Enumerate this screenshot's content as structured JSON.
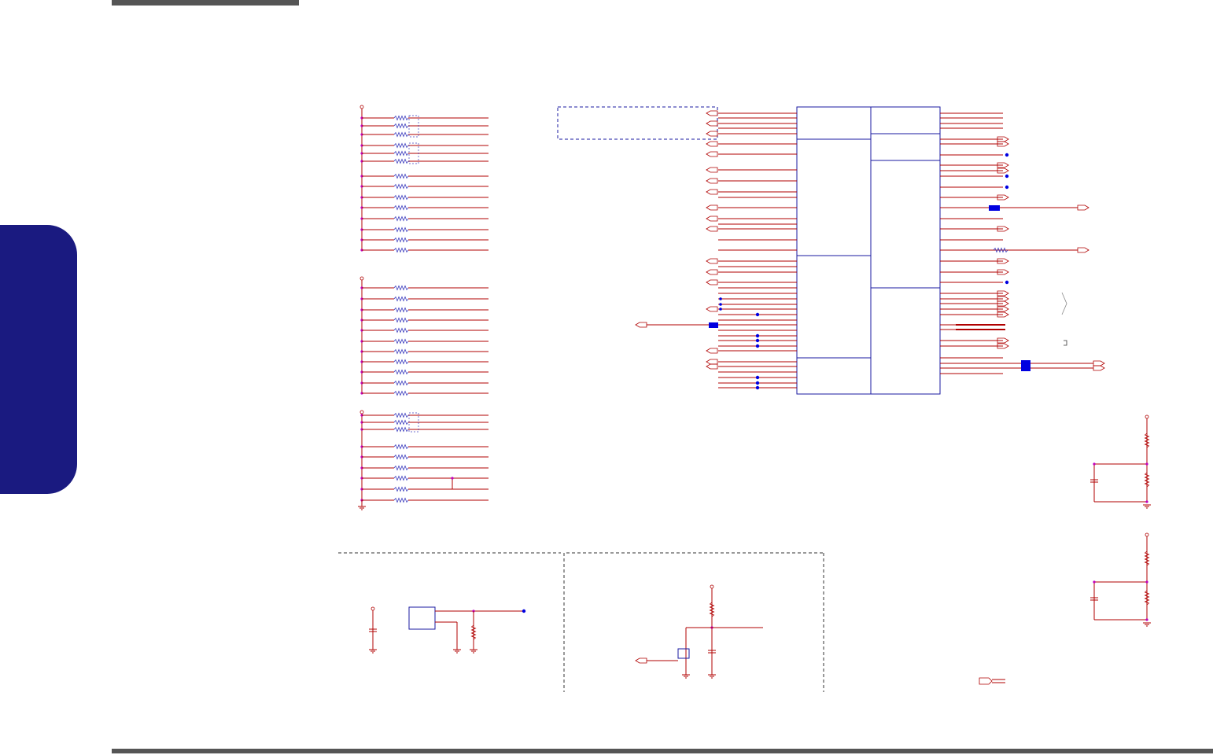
{
  "page": {
    "header_bar": "",
    "side_tab_label": "",
    "footer_bar": ""
  },
  "schematic": {
    "colors": {
      "wire": "#b00000",
      "bus_box": "#1a1aa0",
      "component": "#4040c0",
      "pin_marker": "#c000c0",
      "junction": "#0000e0",
      "ground": "#b00000"
    },
    "blocks": [
      "pull-up-resistor-bank-1",
      "pull-up-resistor-bank-2",
      "pull-up-resistor-bank-3",
      "main-ic",
      "voltage-regulator-section",
      "mosfet-switch-section",
      "resistor-divider-1",
      "resistor-divider-2"
    ]
  }
}
